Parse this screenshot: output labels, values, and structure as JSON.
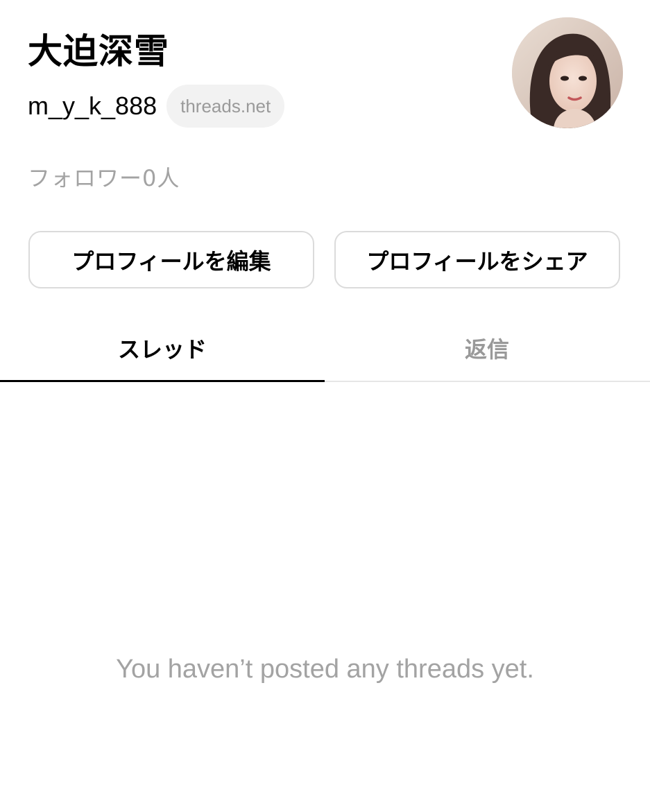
{
  "profile": {
    "display_name": "大迫深雪",
    "username": "m_y_k_888",
    "domain_badge": "threads.net",
    "followers_text": "フォロワー0人"
  },
  "actions": {
    "edit_label": "プロフィールを編集",
    "share_label": "プロフィールをシェア"
  },
  "tabs": [
    {
      "label": "スレッド",
      "active": true
    },
    {
      "label": "返信",
      "active": false
    }
  ],
  "content": {
    "empty_message": "You haven’t posted any threads yet."
  },
  "colors": {
    "text_primary": "#000000",
    "text_secondary": "#a3a3a3",
    "badge_background": "#f2f2f2",
    "border": "#dbdbdb"
  }
}
